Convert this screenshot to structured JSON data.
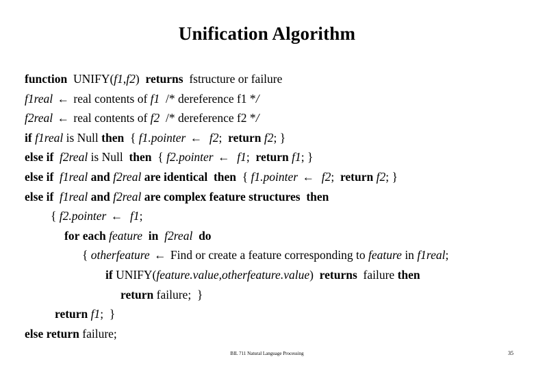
{
  "slide": {
    "title": "Unification Algorithm",
    "background_color": "#ffffff",
    "text_color": "#000000"
  },
  "algorithm": {
    "arrow_glyph": "←",
    "lines": [
      {
        "id": "line-1-function-signature",
        "indent": 0,
        "text": "function  UNIFY(f1,f2)  returns  fstructure or failure",
        "tokens": [
          {
            "t": "function",
            "s": "kw"
          },
          {
            "t": "  ",
            "s": "pl"
          },
          {
            "t": "UNIFY(",
            "s": "pl"
          },
          {
            "t": "f1",
            "s": "var"
          },
          {
            "t": ",",
            "s": "pl"
          },
          {
            "t": "f2",
            "s": "var"
          },
          {
            "t": ")",
            "s": "pl"
          },
          {
            "t": "  ",
            "s": "pl"
          },
          {
            "t": "returns",
            "s": "kw"
          },
          {
            "t": "  fstructure or failure",
            "s": "pl"
          }
        ]
      },
      {
        "id": "line-2-deref-f1",
        "indent": 0,
        "text": "f1real ← real contents of f1  /* dereference f1 */",
        "tokens": [
          {
            "t": "f1real",
            "s": "var"
          },
          {
            "t": " ",
            "s": "pl"
          },
          {
            "t": "←",
            "s": "arrow"
          },
          {
            "t": " ",
            "s": "pl"
          },
          {
            "t": "real contents of ",
            "s": "pl"
          },
          {
            "t": "f1",
            "s": "var"
          },
          {
            "t": "  ",
            "s": "pl"
          },
          {
            "t": "/* dereference f1 *",
            "s": "pl"
          },
          {
            "t": "/",
            "s": "var"
          }
        ]
      },
      {
        "id": "line-3-deref-f2",
        "indent": 0,
        "text": "f2real ← real contents of f2  /* dereference f2 */",
        "tokens": [
          {
            "t": "f2real",
            "s": "var"
          },
          {
            "t": " ",
            "s": "pl"
          },
          {
            "t": "←",
            "s": "arrow"
          },
          {
            "t": " ",
            "s": "pl"
          },
          {
            "t": "real contents of ",
            "s": "pl"
          },
          {
            "t": "f2",
            "s": "var"
          },
          {
            "t": "  ",
            "s": "pl"
          },
          {
            "t": "/* dereference f2 *",
            "s": "pl"
          },
          {
            "t": "/",
            "s": "var"
          }
        ]
      },
      {
        "id": "line-4-if-f1real-null",
        "indent": 0,
        "text": "if f1real is Null then  { f1.pointer ← f2; return f2; }",
        "tokens": [
          {
            "t": "if",
            "s": "kw"
          },
          {
            "t": " ",
            "s": "pl"
          },
          {
            "t": "f1real",
            "s": "var"
          },
          {
            "t": " is Null ",
            "s": "pl"
          },
          {
            "t": "then",
            "s": "kw"
          },
          {
            "t": "  { ",
            "s": "pl"
          },
          {
            "t": "f1.pointer",
            "s": "var"
          },
          {
            "t": " ",
            "s": "pl"
          },
          {
            "t": "←",
            "s": "arrow"
          },
          {
            "t": "  ",
            "s": "pl"
          },
          {
            "t": "f2",
            "s": "var"
          },
          {
            "t": ";  ",
            "s": "pl"
          },
          {
            "t": "return",
            "s": "kw"
          },
          {
            "t": " ",
            "s": "pl"
          },
          {
            "t": "f2",
            "s": "var"
          },
          {
            "t": "; }",
            "s": "pl"
          }
        ]
      },
      {
        "id": "line-5-else-if-f2real-null",
        "indent": 0,
        "text": "else if f2real is Null then  { f2.pointer ← f1; return f1; }",
        "tokens": [
          {
            "t": "else if",
            "s": "kw"
          },
          {
            "t": "  ",
            "s": "pl"
          },
          {
            "t": "f2real",
            "s": "var"
          },
          {
            "t": " is Null  ",
            "s": "pl"
          },
          {
            "t": "then",
            "s": "kw"
          },
          {
            "t": "  { ",
            "s": "pl"
          },
          {
            "t": "f2.pointer",
            "s": "var"
          },
          {
            "t": " ",
            "s": "pl"
          },
          {
            "t": "←",
            "s": "arrow"
          },
          {
            "t": "  ",
            "s": "pl"
          },
          {
            "t": "f1",
            "s": "var"
          },
          {
            "t": ";  ",
            "s": "pl"
          },
          {
            "t": "return",
            "s": "kw"
          },
          {
            "t": " ",
            "s": "pl"
          },
          {
            "t": "f1",
            "s": "var"
          },
          {
            "t": "; }",
            "s": "pl"
          }
        ]
      },
      {
        "id": "line-6-else-if-identical",
        "indent": 0,
        "text": "else if f1real and f2real are identical then  { f1.pointer ← f2; return f2; }",
        "tokens": [
          {
            "t": "else if",
            "s": "kw"
          },
          {
            "t": "  ",
            "s": "pl"
          },
          {
            "t": "f1real",
            "s": "var"
          },
          {
            "t": " ",
            "s": "pl"
          },
          {
            "t": "and",
            "s": "kw"
          },
          {
            "t": " ",
            "s": "pl"
          },
          {
            "t": "f2real",
            "s": "var"
          },
          {
            "t": " ",
            "s": "pl"
          },
          {
            "t": "are identical",
            "s": "kw"
          },
          {
            "t": "  ",
            "s": "pl"
          },
          {
            "t": "then",
            "s": "kw"
          },
          {
            "t": "  { ",
            "s": "pl"
          },
          {
            "t": "f1.pointer",
            "s": "var"
          },
          {
            "t": " ",
            "s": "pl"
          },
          {
            "t": "←",
            "s": "arrow"
          },
          {
            "t": "  ",
            "s": "pl"
          },
          {
            "t": "f2",
            "s": "var"
          },
          {
            "t": ";  ",
            "s": "pl"
          },
          {
            "t": "return",
            "s": "kw"
          },
          {
            "t": " ",
            "s": "pl"
          },
          {
            "t": "f2",
            "s": "var"
          },
          {
            "t": "; }",
            "s": "pl"
          }
        ]
      },
      {
        "id": "line-7-else-if-complex",
        "indent": 0,
        "text": "else if f1real and f2real are complex feature structures then",
        "tokens": [
          {
            "t": "else if",
            "s": "kw"
          },
          {
            "t": "  ",
            "s": "pl"
          },
          {
            "t": "f1real",
            "s": "var"
          },
          {
            "t": " ",
            "s": "pl"
          },
          {
            "t": "and",
            "s": "kw"
          },
          {
            "t": " ",
            "s": "pl"
          },
          {
            "t": "f2real",
            "s": "var"
          },
          {
            "t": " ",
            "s": "pl"
          },
          {
            "t": "are complex feature structures",
            "s": "kw"
          },
          {
            "t": "  ",
            "s": "pl"
          },
          {
            "t": "then",
            "s": "kw"
          }
        ]
      },
      {
        "id": "line-8-open-brace-f2pointer",
        "indent": 1,
        "text": "{ f2.pointer ← f1;",
        "tokens": [
          {
            "t": "{ ",
            "s": "pl"
          },
          {
            "t": "f2.pointer",
            "s": "var"
          },
          {
            "t": " ",
            "s": "pl"
          },
          {
            "t": "←",
            "s": "arrow"
          },
          {
            "t": "  ",
            "s": "pl"
          },
          {
            "t": "f1",
            "s": "var"
          },
          {
            "t": ";",
            "s": "pl"
          }
        ]
      },
      {
        "id": "line-9-for-each-feature",
        "indent": 2,
        "text": "for each feature in f2real do",
        "tokens": [
          {
            "t": "for each",
            "s": "kw"
          },
          {
            "t": " ",
            "s": "pl"
          },
          {
            "t": "feature",
            "s": "var"
          },
          {
            "t": "  ",
            "s": "pl"
          },
          {
            "t": "in",
            "s": "kw"
          },
          {
            "t": "  ",
            "s": "pl"
          },
          {
            "t": "f2real",
            "s": "var"
          },
          {
            "t": "  ",
            "s": "pl"
          },
          {
            "t": "do",
            "s": "kw"
          }
        ]
      },
      {
        "id": "line-10-otherfeature-assign",
        "indent": 3,
        "text": "{ otherfeature ← Find or create a feature corresponding to feature in f1real;",
        "tokens": [
          {
            "t": "{ ",
            "s": "pl"
          },
          {
            "t": "otherfeature",
            "s": "var"
          },
          {
            "t": " ",
            "s": "pl"
          },
          {
            "t": "←",
            "s": "arrow"
          },
          {
            "t": " Find or create a feature corresponding to ",
            "s": "pl"
          },
          {
            "t": "feature",
            "s": "var"
          },
          {
            "t": " in ",
            "s": "pl"
          },
          {
            "t": "f1real",
            "s": "var"
          },
          {
            "t": ";",
            "s": "pl"
          }
        ]
      },
      {
        "id": "line-11-if-unify-returns-failure",
        "indent": 4,
        "text": "if UNIFY(feature.value,otherfeature.value) returns failure then",
        "tokens": [
          {
            "t": "if",
            "s": "kw"
          },
          {
            "t": " UNIFY(",
            "s": "pl"
          },
          {
            "t": "feature.value,otherfeature.value",
            "s": "var"
          },
          {
            "t": ")",
            "s": "pl"
          },
          {
            "t": "  ",
            "s": "pl"
          },
          {
            "t": "returns",
            "s": "kw"
          },
          {
            "t": "  failure ",
            "s": "pl"
          },
          {
            "t": "then",
            "s": "kw"
          }
        ]
      },
      {
        "id": "line-12-return-failure-inner",
        "indent": 5,
        "text": "return failure; }",
        "tokens": [
          {
            "t": "return",
            "s": "kw"
          },
          {
            "t": " failure;  }",
            "s": "pl"
          }
        ]
      },
      {
        "id": "line-13-return-f1",
        "indent": 6,
        "text": "return f1; }",
        "tokens": [
          {
            "t": "return",
            "s": "kw"
          },
          {
            "t": " ",
            "s": "pl"
          },
          {
            "t": "f1",
            "s": "var"
          },
          {
            "t": ";  }",
            "s": "pl"
          }
        ]
      },
      {
        "id": "line-14-else-return-failure",
        "indent": 0,
        "text": "else return failure;",
        "tokens": [
          {
            "t": "else return",
            "s": "kw"
          },
          {
            "t": " failure;",
            "s": "pl"
          }
        ]
      }
    ]
  },
  "footer": {
    "course": "BIL 711 Natural Language Processing",
    "page_number": "35"
  }
}
